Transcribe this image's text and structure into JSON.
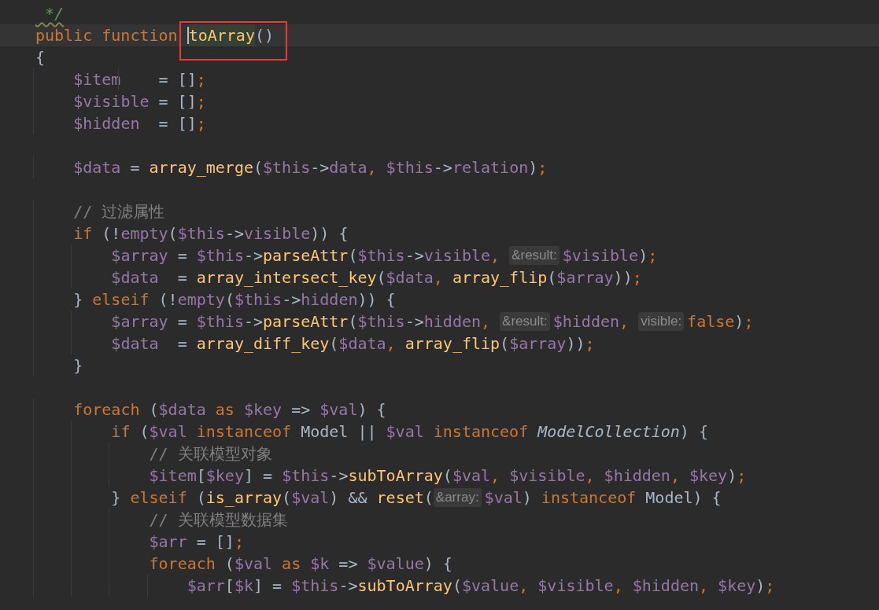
{
  "editor": {
    "lines": [
      {
        "kind": "code",
        "tokens": [
          {
            "kind": "doc",
            "text": " */"
          }
        ]
      },
      {
        "kind": "current",
        "tokens": [
          {
            "kind": "kw",
            "text": "public function "
          },
          {
            "kind": "boxed",
            "tokens": [
              {
                "kind": "caret"
              },
              {
                "kind": "fnhl",
                "text": "toArray"
              },
              {
                "kind": "plain",
                "text": "()"
              }
            ]
          }
        ]
      },
      {
        "kind": "code",
        "tokens": [
          {
            "kind": "plain",
            "text": "{"
          }
        ]
      },
      {
        "kind": "code",
        "tokens": [
          {
            "kind": "var",
            "text": "    $item"
          },
          {
            "kind": "plain",
            "text": "    = []"
          },
          {
            "kind": "kw",
            "text": ";"
          }
        ]
      },
      {
        "kind": "code",
        "tokens": [
          {
            "kind": "var",
            "text": "    $visible"
          },
          {
            "kind": "plain",
            "text": " = []"
          },
          {
            "kind": "kw",
            "text": ";"
          }
        ]
      },
      {
        "kind": "code",
        "tokens": [
          {
            "kind": "var",
            "text": "    $hidden"
          },
          {
            "kind": "plain",
            "text": "  = []"
          },
          {
            "kind": "kw",
            "text": ";"
          }
        ]
      },
      {
        "kind": "code"
      },
      {
        "kind": "code",
        "tokens": [
          {
            "kind": "var",
            "text": "    $data"
          },
          {
            "kind": "plain",
            "text": " = "
          },
          {
            "kind": "fn",
            "text": "array_merge"
          },
          {
            "kind": "plain",
            "text": "("
          },
          {
            "kind": "var",
            "text": "$this"
          },
          {
            "kind": "plain",
            "text": "->"
          },
          {
            "kind": "var",
            "text": "data"
          },
          {
            "kind": "kw",
            "text": ", "
          },
          {
            "kind": "var",
            "text": "$this"
          },
          {
            "kind": "plain",
            "text": "->"
          },
          {
            "kind": "var",
            "text": "relation"
          },
          {
            "kind": "plain",
            "text": ")"
          },
          {
            "kind": "kw",
            "text": ";"
          }
        ]
      },
      {
        "kind": "code"
      },
      {
        "kind": "code",
        "tokens": [
          {
            "kind": "cmt",
            "text": "    // 过滤属性"
          }
        ]
      },
      {
        "kind": "code",
        "tokens": [
          {
            "kind": "kw",
            "text": "    if "
          },
          {
            "kind": "plain",
            "text": "(!"
          },
          {
            "kind": "var",
            "text": "empty"
          },
          {
            "kind": "plain",
            "text": "("
          },
          {
            "kind": "var",
            "text": "$this"
          },
          {
            "kind": "plain",
            "text": "->"
          },
          {
            "kind": "var",
            "text": "visible"
          },
          {
            "kind": "plain",
            "text": ")) {"
          }
        ]
      },
      {
        "kind": "code",
        "tokens": [
          {
            "kind": "var",
            "text": "        $array"
          },
          {
            "kind": "plain",
            "text": " = "
          },
          {
            "kind": "var",
            "text": "$this"
          },
          {
            "kind": "plain",
            "text": "->"
          },
          {
            "kind": "fn",
            "text": "parseAttr"
          },
          {
            "kind": "plain",
            "text": "("
          },
          {
            "kind": "var",
            "text": "$this"
          },
          {
            "kind": "plain",
            "text": "->"
          },
          {
            "kind": "var",
            "text": "visible"
          },
          {
            "kind": "kw",
            "text": ", "
          },
          {
            "kind": "hint",
            "text": "&result:"
          },
          {
            "kind": "var",
            "text": "$visible"
          },
          {
            "kind": "plain",
            "text": ")"
          },
          {
            "kind": "kw",
            "text": ";"
          }
        ]
      },
      {
        "kind": "code",
        "tokens": [
          {
            "kind": "var",
            "text": "        $data"
          },
          {
            "kind": "plain",
            "text": "  = "
          },
          {
            "kind": "fn",
            "text": "array_intersect_key"
          },
          {
            "kind": "plain",
            "text": "("
          },
          {
            "kind": "var",
            "text": "$data"
          },
          {
            "kind": "kw",
            "text": ", "
          },
          {
            "kind": "fn",
            "text": "array_flip"
          },
          {
            "kind": "plain",
            "text": "("
          },
          {
            "kind": "var",
            "text": "$array"
          },
          {
            "kind": "plain",
            "text": "))"
          },
          {
            "kind": "kw",
            "text": ";"
          }
        ]
      },
      {
        "kind": "code",
        "tokens": [
          {
            "kind": "plain",
            "text": "    } "
          },
          {
            "kind": "kw",
            "text": "elseif "
          },
          {
            "kind": "plain",
            "text": "(!"
          },
          {
            "kind": "var",
            "text": "empty"
          },
          {
            "kind": "plain",
            "text": "("
          },
          {
            "kind": "var",
            "text": "$this"
          },
          {
            "kind": "plain",
            "text": "->"
          },
          {
            "kind": "var",
            "text": "hidden"
          },
          {
            "kind": "plain",
            "text": ")) {"
          }
        ]
      },
      {
        "kind": "code",
        "tokens": [
          {
            "kind": "var",
            "text": "        $array"
          },
          {
            "kind": "plain",
            "text": " = "
          },
          {
            "kind": "var",
            "text": "$this"
          },
          {
            "kind": "plain",
            "text": "->"
          },
          {
            "kind": "fn",
            "text": "parseAttr"
          },
          {
            "kind": "plain",
            "text": "("
          },
          {
            "kind": "var",
            "text": "$this"
          },
          {
            "kind": "plain",
            "text": "->"
          },
          {
            "kind": "var",
            "text": "hidden"
          },
          {
            "kind": "kw",
            "text": ", "
          },
          {
            "kind": "hint",
            "text": "&result:"
          },
          {
            "kind": "var",
            "text": "$hidden"
          },
          {
            "kind": "kw",
            "text": ", "
          },
          {
            "kind": "hint",
            "text": "visible:"
          },
          {
            "kind": "kw",
            "text": "false"
          },
          {
            "kind": "plain",
            "text": ")"
          },
          {
            "kind": "kw",
            "text": ";"
          }
        ]
      },
      {
        "kind": "code",
        "tokens": [
          {
            "kind": "var",
            "text": "        $data"
          },
          {
            "kind": "plain",
            "text": "  = "
          },
          {
            "kind": "fn",
            "text": "array_diff_key"
          },
          {
            "kind": "plain",
            "text": "("
          },
          {
            "kind": "var",
            "text": "$data"
          },
          {
            "kind": "kw",
            "text": ", "
          },
          {
            "kind": "fn",
            "text": "array_flip"
          },
          {
            "kind": "plain",
            "text": "("
          },
          {
            "kind": "var",
            "text": "$array"
          },
          {
            "kind": "plain",
            "text": "))"
          },
          {
            "kind": "kw",
            "text": ";"
          }
        ]
      },
      {
        "kind": "code",
        "tokens": [
          {
            "kind": "plain",
            "text": "    }"
          }
        ]
      },
      {
        "kind": "code"
      },
      {
        "kind": "code",
        "tokens": [
          {
            "kind": "kw",
            "text": "    foreach "
          },
          {
            "kind": "plain",
            "text": "("
          },
          {
            "kind": "var",
            "text": "$data"
          },
          {
            "kind": "kw",
            "text": " as "
          },
          {
            "kind": "var",
            "text": "$key"
          },
          {
            "kind": "plain",
            "text": " => "
          },
          {
            "kind": "var",
            "text": "$val"
          },
          {
            "kind": "plain",
            "text": ") {"
          }
        ]
      },
      {
        "kind": "code",
        "tokens": [
          {
            "kind": "kw",
            "text": "        if "
          },
          {
            "kind": "plain",
            "text": "("
          },
          {
            "kind": "var",
            "text": "$val"
          },
          {
            "kind": "kw",
            "text": " instanceof "
          },
          {
            "kind": "plain",
            "text": "Model || "
          },
          {
            "kind": "var",
            "text": "$val"
          },
          {
            "kind": "kw",
            "text": " instanceof "
          },
          {
            "kind": "italic",
            "text": "ModelCollection"
          },
          {
            "kind": "plain",
            "text": ") {"
          }
        ]
      },
      {
        "kind": "code",
        "tokens": [
          {
            "kind": "cmt",
            "text": "            // 关联模型对象"
          }
        ]
      },
      {
        "kind": "code",
        "tokens": [
          {
            "kind": "var",
            "text": "            $item"
          },
          {
            "kind": "plain",
            "text": "["
          },
          {
            "kind": "var",
            "text": "$key"
          },
          {
            "kind": "plain",
            "text": "] = "
          },
          {
            "kind": "var",
            "text": "$this"
          },
          {
            "kind": "plain",
            "text": "->"
          },
          {
            "kind": "fn",
            "text": "subToArray"
          },
          {
            "kind": "plain",
            "text": "("
          },
          {
            "kind": "var",
            "text": "$val"
          },
          {
            "kind": "kw",
            "text": ", "
          },
          {
            "kind": "var",
            "text": "$visible"
          },
          {
            "kind": "kw",
            "text": ", "
          },
          {
            "kind": "var",
            "text": "$hidden"
          },
          {
            "kind": "kw",
            "text": ", "
          },
          {
            "kind": "var",
            "text": "$key"
          },
          {
            "kind": "plain",
            "text": ")"
          },
          {
            "kind": "kw",
            "text": ";"
          }
        ]
      },
      {
        "kind": "code",
        "tokens": [
          {
            "kind": "plain",
            "text": "        } "
          },
          {
            "kind": "kw",
            "text": "elseif "
          },
          {
            "kind": "plain",
            "text": "("
          },
          {
            "kind": "fn",
            "text": "is_array"
          },
          {
            "kind": "plain",
            "text": "("
          },
          {
            "kind": "var",
            "text": "$val"
          },
          {
            "kind": "plain",
            "text": ") && "
          },
          {
            "kind": "fn",
            "text": "reset"
          },
          {
            "kind": "plain",
            "text": "("
          },
          {
            "kind": "hint",
            "text": "&array:"
          },
          {
            "kind": "var",
            "text": "$val"
          },
          {
            "kind": "plain",
            "text": ")"
          },
          {
            "kind": "kw",
            "text": " instanceof "
          },
          {
            "kind": "plain",
            "text": "Model) {"
          }
        ]
      },
      {
        "kind": "code",
        "tokens": [
          {
            "kind": "cmt",
            "text": "            // 关联模型数据集"
          }
        ]
      },
      {
        "kind": "code",
        "tokens": [
          {
            "kind": "var",
            "text": "            $arr"
          },
          {
            "kind": "plain",
            "text": " = []"
          },
          {
            "kind": "kw",
            "text": ";"
          }
        ]
      },
      {
        "kind": "code",
        "tokens": [
          {
            "kind": "kw",
            "text": "            foreach "
          },
          {
            "kind": "plain",
            "text": "("
          },
          {
            "kind": "var",
            "text": "$val"
          },
          {
            "kind": "kw",
            "text": " as "
          },
          {
            "kind": "var",
            "text": "$k"
          },
          {
            "kind": "plain",
            "text": " => "
          },
          {
            "kind": "var",
            "text": "$value"
          },
          {
            "kind": "plain",
            "text": ") {"
          }
        ]
      },
      {
        "kind": "code",
        "tokens": [
          {
            "kind": "var",
            "text": "                $arr"
          },
          {
            "kind": "plain",
            "text": "["
          },
          {
            "kind": "var",
            "text": "$k"
          },
          {
            "kind": "plain",
            "text": "] = "
          },
          {
            "kind": "var",
            "text": "$this"
          },
          {
            "kind": "plain",
            "text": "->"
          },
          {
            "kind": "fn",
            "text": "subToArray"
          },
          {
            "kind": "plain",
            "text": "("
          },
          {
            "kind": "var",
            "text": "$value"
          },
          {
            "kind": "kw",
            "text": ", "
          },
          {
            "kind": "var",
            "text": "$visible"
          },
          {
            "kind": "kw",
            "text": ", "
          },
          {
            "kind": "var",
            "text": "$hidden"
          },
          {
            "kind": "kw",
            "text": ", "
          },
          {
            "kind": "var",
            "text": "$key"
          },
          {
            "kind": "plain",
            "text": ")"
          },
          {
            "kind": "kw",
            "text": ";"
          }
        ]
      }
    ]
  }
}
